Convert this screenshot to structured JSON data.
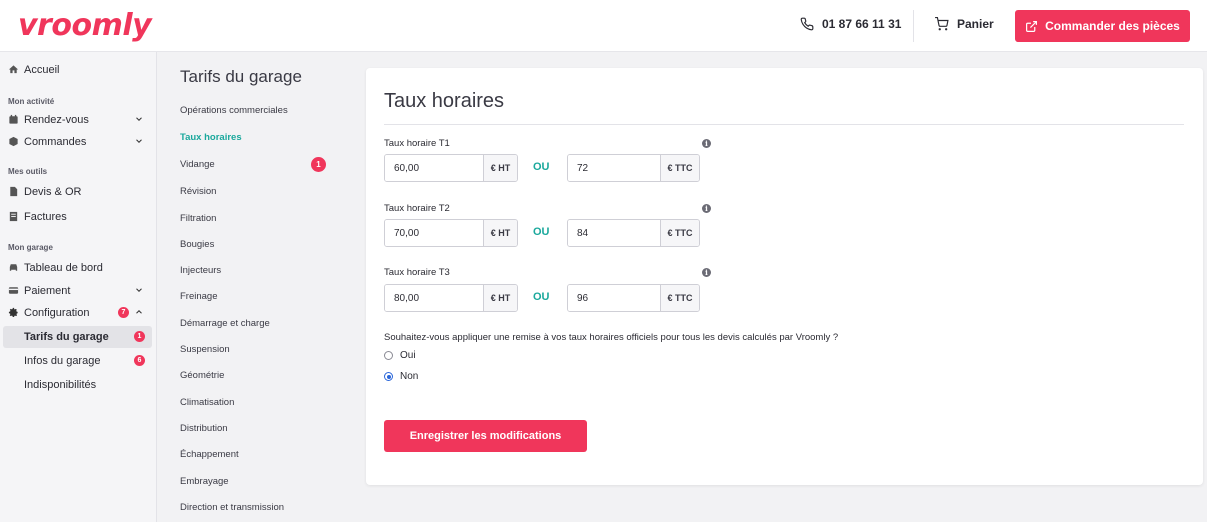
{
  "header": {
    "logo": "vroomly",
    "phone": "01 87 66 11 31",
    "cart_label": "Panier",
    "order_button": "Commander des pièces"
  },
  "sidebar": {
    "home": "Accueil",
    "section_activity": "Mon activité",
    "appointments": "Rendez-vous",
    "orders": "Commandes",
    "section_tools": "Mes outils",
    "quotes": "Devis & OR",
    "invoices": "Factures",
    "section_garage": "Mon garage",
    "dashboard": "Tableau de bord",
    "payment": "Paiement",
    "configuration": "Configuration",
    "configuration_badge": "7",
    "garage_rates": "Tarifs du garage",
    "garage_rates_badge": "1",
    "garage_info": "Infos du garage",
    "garage_info_badge": "6",
    "unavailability": "Indisponibilités"
  },
  "subnav": {
    "title": "Tarifs du garage",
    "items": [
      "Opérations commerciales",
      "Taux horaires",
      "Vidange",
      "Révision",
      "Filtration",
      "Bougies",
      "Injecteurs",
      "Freinage",
      "Démarrage et charge",
      "Suspension",
      "Géométrie",
      "Climatisation",
      "Distribution",
      "Échappement",
      "Embrayage",
      "Direction et transmission"
    ],
    "active_index": 1,
    "vidange_badge": "1"
  },
  "card": {
    "title": "Taux horaires",
    "or_label": "OU",
    "ht_unit": "€ HT",
    "ttc_unit": "€ TTC",
    "info_glyph": "i",
    "rates": [
      {
        "label": "Taux horaire T1",
        "ht": "60,00",
        "ttc": "72"
      },
      {
        "label": "Taux horaire T2",
        "ht": "70,00",
        "ttc": "84"
      },
      {
        "label": "Taux horaire T3",
        "ht": "80,00",
        "ttc": "96"
      }
    ],
    "question": "Souhaitez-vous appliquer une remise à vos taux horaires officiels pour tous les devis calculés par Vroomly ?",
    "option_yes": "Oui",
    "option_no": "Non",
    "selected_option": "Non",
    "save_button": "Enregistrer les modifications"
  },
  "colors": {
    "brand": "#f0365b",
    "accent": "#1aa89c",
    "radio": "#2a66d9"
  }
}
